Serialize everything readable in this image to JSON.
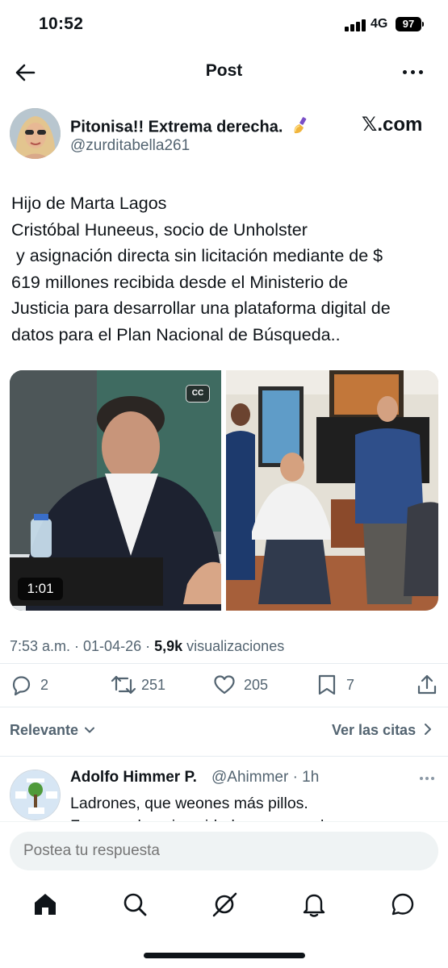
{
  "status_bar": {
    "time": "10:52",
    "network": "4G",
    "battery": "97"
  },
  "header": {
    "title": "Post",
    "back_icon": "arrow-left-icon",
    "more_icon": "ellipsis-icon"
  },
  "post": {
    "author_name": "Pitonisa!! Extrema derecha.",
    "author_emoji": "nail-polish-emoji",
    "author_handle": "@zurditabella261",
    "source_watermark": "𝕏.com",
    "text_lines": [
      "Hijo de Marta Lagos",
      "Cristóbal Huneeus, socio de Unholster",
      " y asignación directa sin licitación mediante de $",
      "619 millones recibida desde el Ministerio de",
      "Justicia para desarrollar una plataforma digital de",
      "datos para el Plan Nacional de Búsqueda.."
    ],
    "video_duration": "1:01",
    "cc_label": "CC",
    "timestamp": "7:53 a.m. · 01-04-26 · ",
    "views_count": "5,9k",
    "views_label": " visualizaciones",
    "actions": {
      "replies": "2",
      "reposts": "251",
      "likes": "205",
      "bookmarks": "7"
    }
  },
  "replies_header": {
    "sort_label": "Relevante",
    "quotes_label": "Ver las citas"
  },
  "reply": {
    "author_name": "Adolfo Himmer P.",
    "author_handle": "@Ahimmer · 1h",
    "text_line1": "Ladrones, que weones más pillos.",
    "text_line2": "Fueron a la universidad para aprender a"
  },
  "compose": {
    "placeholder": "Postea tu respuesta"
  },
  "bottom_nav": [
    "home-icon",
    "search-icon",
    "grok-icon",
    "notifications-icon",
    "messages-icon"
  ],
  "colors": {
    "text": "#0f1419",
    "secondary": "#536471",
    "input_bg": "#eff3f4"
  }
}
